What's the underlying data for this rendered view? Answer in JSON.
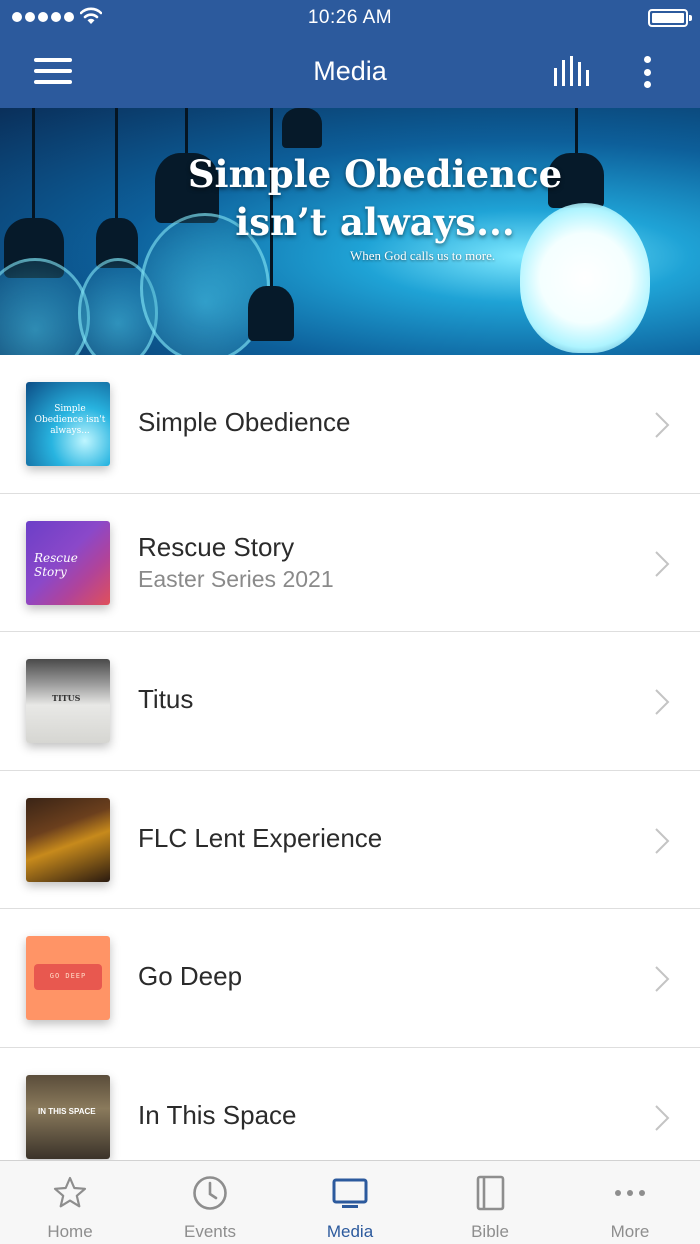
{
  "status_bar": {
    "time": "10:26 AM"
  },
  "header": {
    "title": "Media"
  },
  "banner": {
    "title_line1": "Simple Obedience",
    "title_line2": "isn’t always...",
    "subtitle": "When God calls us to more."
  },
  "list": {
    "items": [
      {
        "title": "Simple Obedience",
        "subtitle": "",
        "thumb_text": "Simple Obedience isn't always..."
      },
      {
        "title": "Rescue Story",
        "subtitle": "Easter Series 2021",
        "thumb_text": "Rescue Story"
      },
      {
        "title": "Titus",
        "subtitle": "",
        "thumb_text": "TITUS"
      },
      {
        "title": "FLC Lent Experience",
        "subtitle": "",
        "thumb_text": ""
      },
      {
        "title": "Go Deep",
        "subtitle": "",
        "thumb_text": "GO DEEP"
      },
      {
        "title": "In This Space",
        "subtitle": "",
        "thumb_text": "IN THIS SPACE"
      }
    ]
  },
  "tabbar": {
    "tabs": [
      {
        "label": "Home",
        "icon": "star-icon"
      },
      {
        "label": "Events",
        "icon": "clock-icon"
      },
      {
        "label": "Media",
        "icon": "tv-icon",
        "active": true
      },
      {
        "label": "Bible",
        "icon": "book-icon"
      },
      {
        "label": "More",
        "icon": "more-dots-icon"
      }
    ]
  },
  "colors": {
    "accent": "#2c5a9d",
    "inactive": "#8e8e8e"
  }
}
